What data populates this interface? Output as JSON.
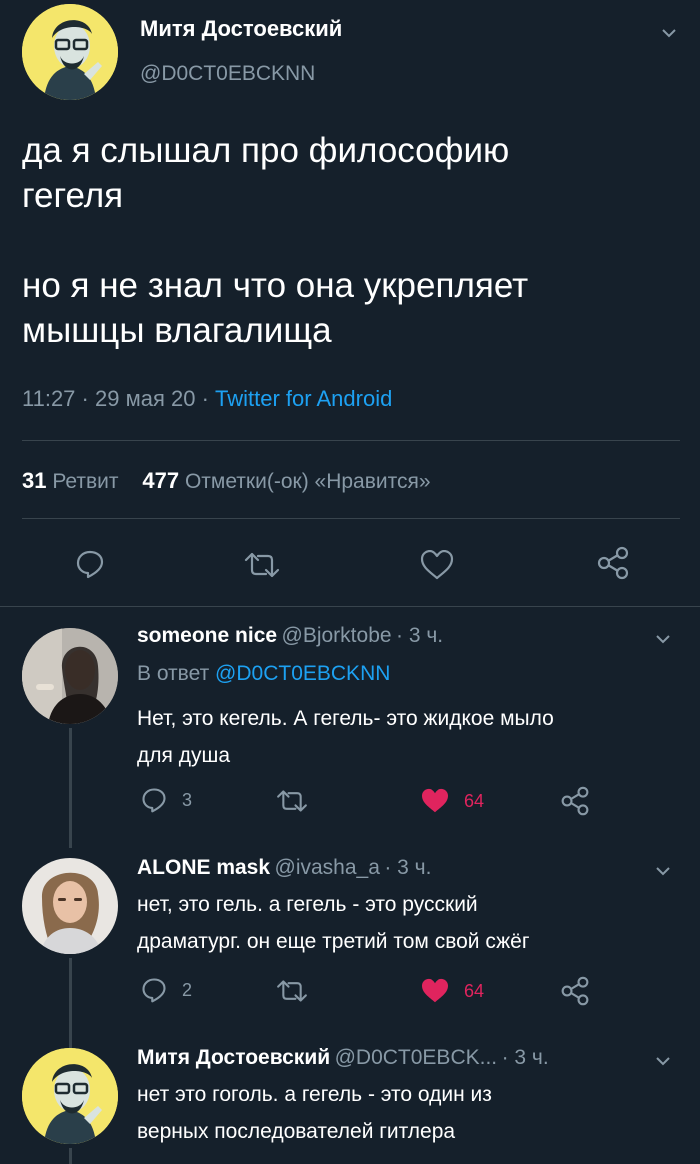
{
  "main_tweet": {
    "author_name": "Митя Достоевский",
    "author_handle": "@D0CT0EBCKNN",
    "text": "да я слышал про философию\nгегеля\n\nно я не знал что она укрепляет\nмышцы влагалища",
    "time": "11:27",
    "sep1": "·",
    "date": "29 мая 20",
    "sep2": "·",
    "client": "Twitter for Android",
    "retweets_count": "31",
    "retweets_label": "Ретвит",
    "likes_count": "477",
    "likes_label": "Отметки(-ок) «Нравится»"
  },
  "replies": [
    {
      "name": "someone nice",
      "handle": "@Bjorktobe",
      "time": "· 3 ч.",
      "in_reply_label": "В ответ",
      "in_reply_handle": "@D0CT0EBCKNN",
      "text": "Нет, это кегель. А гегель- это жидкое мыло\nдля душа",
      "reply_count": "3",
      "like_count": "64"
    },
    {
      "name": "ALONE mask",
      "handle": "@ivasha_a",
      "time": "· 3 ч.",
      "text": "нет, это гель. а гегель - это русский\nдраматург. он еще третий том свой сжёг",
      "reply_count": "2",
      "like_count": "64"
    },
    {
      "name": "Митя Достоевский",
      "handle": "@D0CT0EBCK...",
      "time": "· 3 ч.",
      "text": "нет это гоголь. а гегель - это один из\nверных последователей гитлера"
    }
  ],
  "icons": [
    "chevron-down-icon",
    "reply-icon",
    "retweet-icon",
    "like-icon",
    "share-icon"
  ],
  "colors": {
    "background": "#15202b",
    "muted": "#8899a6",
    "link": "#1da1f2",
    "like_active": "#e0245e",
    "divider": "#38444d"
  }
}
